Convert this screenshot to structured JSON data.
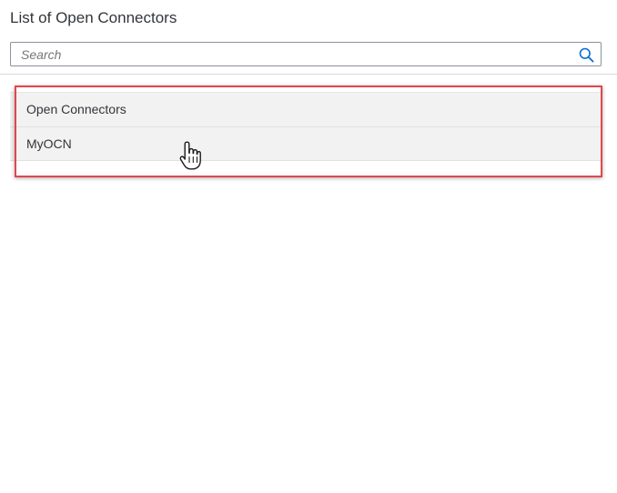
{
  "dialog": {
    "title": "List of Open Connectors"
  },
  "search": {
    "placeholder": "Search",
    "value": "",
    "icon": "search-icon"
  },
  "list": {
    "items": [
      {
        "label": "Open Connectors"
      },
      {
        "label": "MyOCN"
      }
    ]
  },
  "colors": {
    "highlight_border": "#e0474f",
    "search_icon": "#0a6ed1",
    "item_background": "#f2f2f2"
  },
  "cursor": {
    "icon": "hand-pointer-icon"
  }
}
